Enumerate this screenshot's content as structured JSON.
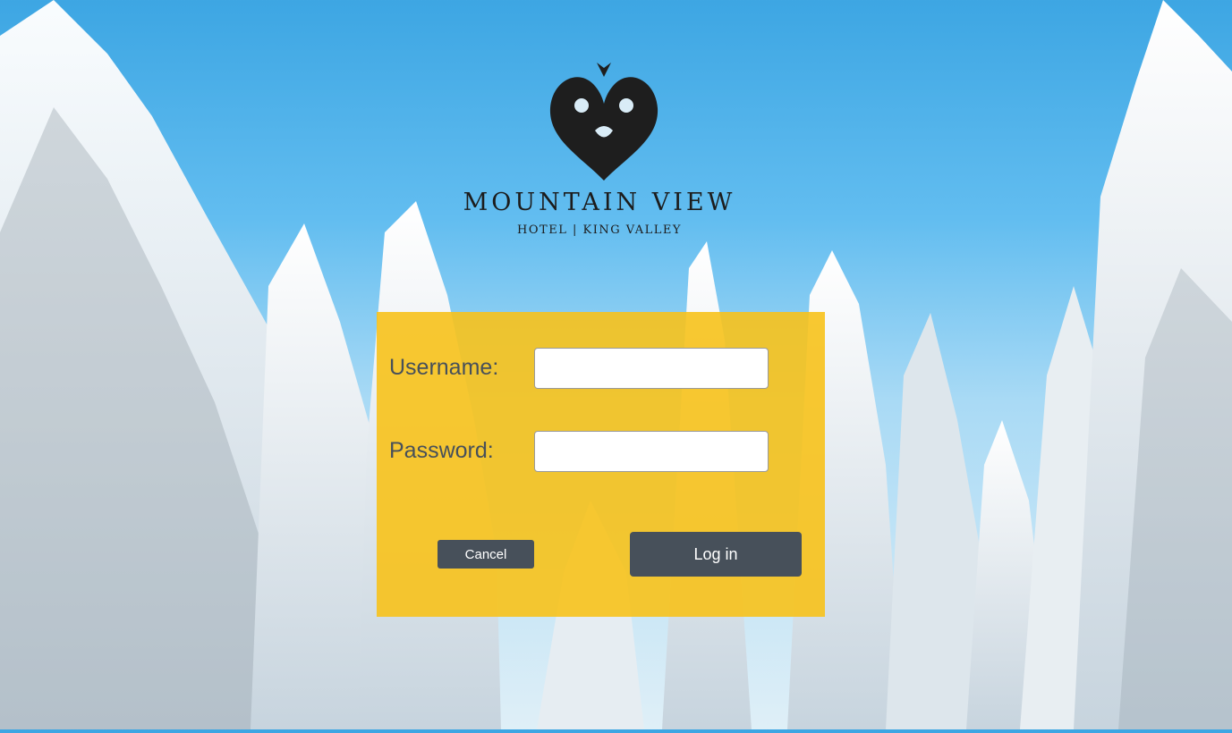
{
  "brand": {
    "title": "MOUNTAIN VIEW",
    "subtitle": "HOTEL | KING VALLEY",
    "logo_icon": "ornamental-heart-emblem-icon"
  },
  "form": {
    "username_label": "Username:",
    "username_value": "",
    "password_label": "Password:",
    "password_value": "",
    "cancel_label": "Cancel",
    "login_label": "Log in"
  },
  "colors": {
    "panel": "#f7c21b",
    "button": "#47505a",
    "label": "#47505a",
    "sky": "#3da6e3",
    "snow": "#ffffff"
  }
}
